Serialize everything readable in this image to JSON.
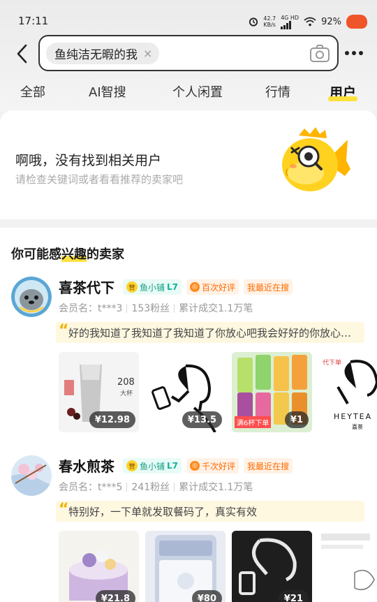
{
  "status_bar": {
    "time": "17:11",
    "net_speed_value": "42.7",
    "net_speed_unit": "KB/s",
    "network_type": "4G HD",
    "battery": "92%",
    "icons": [
      "alarm-icon",
      "signal-icon",
      "wifi-icon",
      "red-envelope-icon"
    ]
  },
  "search": {
    "query_chip": "鱼纯洁无暇的我",
    "clear_symbol": "×",
    "icons": [
      "back-icon",
      "camera-icon",
      "more-icon"
    ]
  },
  "tabs": [
    {
      "label": "全部",
      "active": false
    },
    {
      "label": "AI智搜",
      "active": false
    },
    {
      "label": "个人闲置",
      "active": false
    },
    {
      "label": "行情",
      "active": false
    },
    {
      "label": "用户",
      "active": true
    }
  ],
  "empty_state": {
    "title": "啊哦，没有找到相关用户",
    "subtitle": "请检查关键词或者看看推荐的卖家吧"
  },
  "recommendations": {
    "title_prefix": "你可能感",
    "title_highlight": "兴趣",
    "title_suffix": "的卖家",
    "sellers": [
      {
        "name": "喜茶代下",
        "badge_zan": "赞",
        "badge_level_text": "鱼小铺",
        "badge_level": "L7",
        "rating_badge": "百次好评",
        "rating_icon": "◎",
        "recent_badge": "我最近在搜",
        "member": "会员名：t***3",
        "fans": "153粉丝",
        "deals": "累计成交1.1万笔",
        "quote": "好的我知道了我知道了我知道了你放心吧我会好好的你放心吧我会好好的",
        "goods": [
          {
            "price": "¥12.98",
            "label": "208",
            "label2": "大杯"
          },
          {
            "price": "¥13.5"
          },
          {
            "price": "¥1",
            "label": "满6杯下单"
          },
          {
            "price": "",
            "label": "HEYTEA",
            "label2": "喜茶",
            "label3": "代下单"
          }
        ]
      },
      {
        "name": "春水煎茶",
        "badge_zan": "赞",
        "badge_level_text": "鱼小铺",
        "badge_level": "L7",
        "rating_badge": "千次好评",
        "rating_icon": "◎",
        "recent_badge": "我最近在搜",
        "member": "会员名：t***5",
        "fans": "241粉丝",
        "deals": "累计成交1.1万笔",
        "quote": "特别好，一下单就发取餐码了，真实有效",
        "goods": [
          {
            "price": "¥21.8"
          },
          {
            "price": "¥80"
          },
          {
            "price": "¥21"
          },
          {
            "price": ""
          }
        ]
      }
    ]
  },
  "colors": {
    "accent_yellow": "#ffe13d",
    "badge_green": "#16a085",
    "badge_orange": "#ff6a00",
    "quote_bg": "#fff8e1"
  }
}
